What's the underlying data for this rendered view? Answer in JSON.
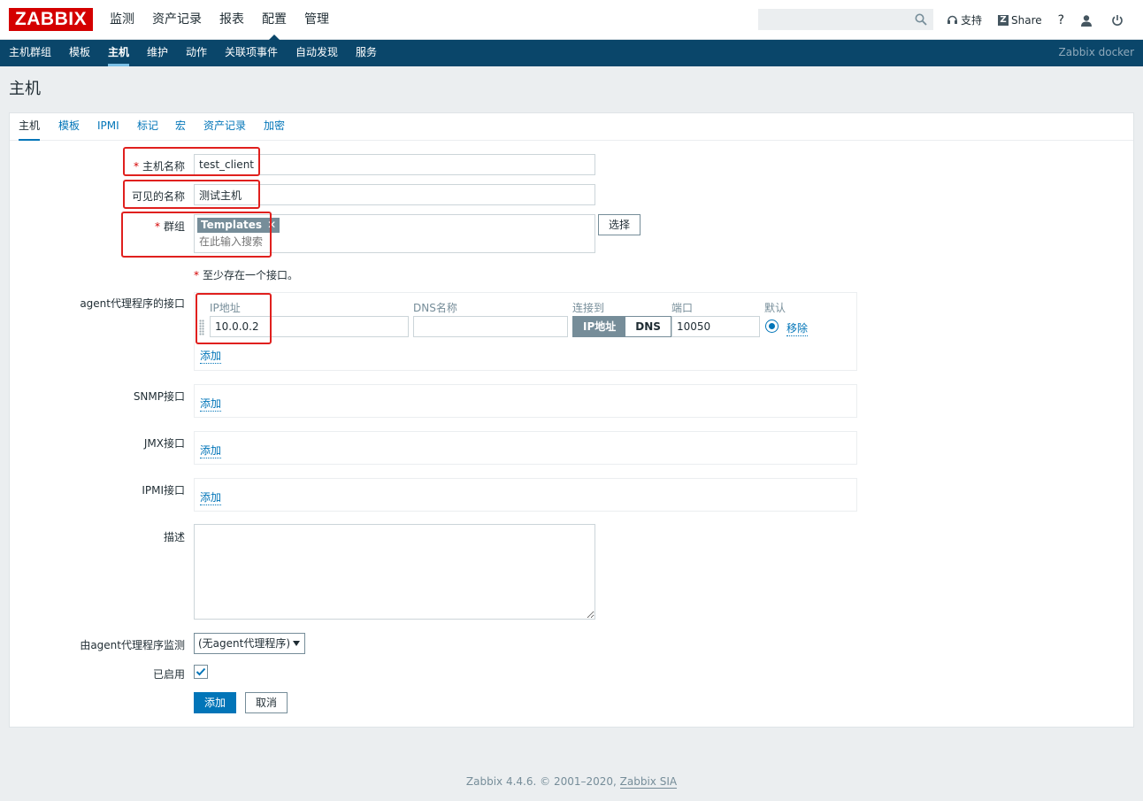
{
  "header": {
    "logo": "ZABBIX",
    "main_menu": [
      "监测",
      "资产记录",
      "报表",
      "配置",
      "管理"
    ],
    "search_placeholder": "",
    "support_label": "支持",
    "share_label": "Share",
    "help_label": "?"
  },
  "subnav": {
    "items": [
      "主机群组",
      "模板",
      "主机",
      "维护",
      "动作",
      "关联项事件",
      "自动发现",
      "服务"
    ],
    "right_label": "Zabbix docker"
  },
  "page_title": "主机",
  "tabs": [
    "主机",
    "模板",
    "IPMI",
    "标记",
    "宏",
    "资产记录",
    "加密"
  ],
  "form": {
    "host_name_label": "主机名称",
    "host_name_value": "test_client",
    "visible_name_label": "可见的名称",
    "visible_name_value": "测试主机",
    "groups_label": "群组",
    "group_chip": "Templates",
    "group_chip_x": "✕",
    "groups_placeholder": "在此输入搜索",
    "select_button": "选择",
    "note_star": "*",
    "note_text": "至少存在一个接口。",
    "agent_label": "agent代理程序的接口",
    "col_ip": "IP地址",
    "col_dns": "DNS名称",
    "col_connect": "连接到",
    "col_port": "端口",
    "col_default": "默认",
    "ip_value": "10.0.0.2",
    "dns_value": "",
    "connect_ip": "IP地址",
    "connect_dns": "DNS",
    "port_value": "10050",
    "remove_label": "移除",
    "add_label": "添加",
    "snmp_label": "SNMP接口",
    "jmx_label": "JMX接口",
    "ipmi_label": "IPMI接口",
    "desc_label": "描述",
    "monitored_by_label": "由agent代理程序监测",
    "monitored_by_value": "(无agent代理程序)",
    "enabled_label": "已启用",
    "add_button": "添加",
    "cancel_button": "取消"
  },
  "footer": {
    "text": "Zabbix 4.4.6. © 2001–2020, ",
    "link": "Zabbix SIA"
  },
  "colors": {
    "brand_red": "#d40000",
    "subnav_bg": "#0a466a",
    "link_blue": "#0275b8",
    "highlight_red": "#e0201e"
  }
}
